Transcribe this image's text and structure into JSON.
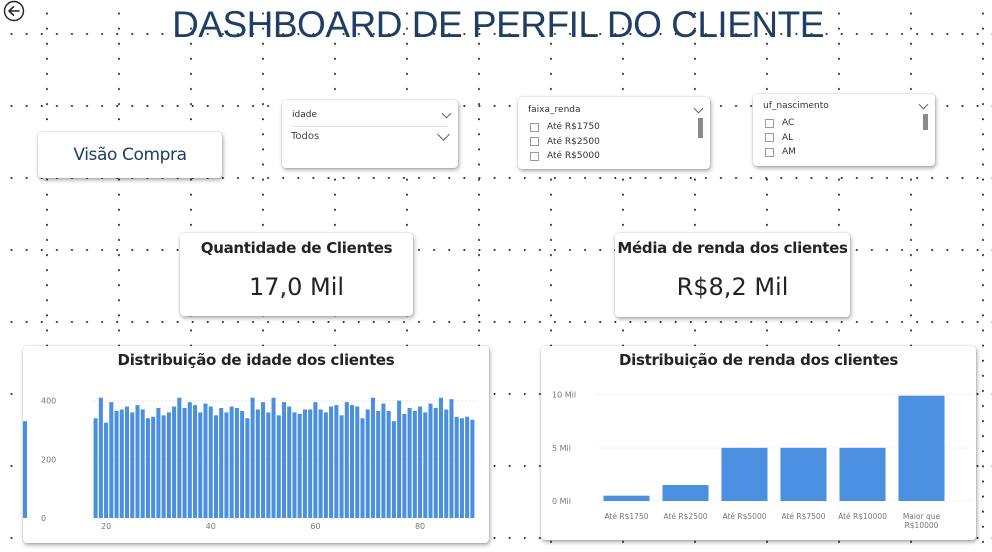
{
  "header": {
    "title": "DASHBOARD DE PERFIL DO CLIENTE"
  },
  "nav": {
    "visao_label": "Visão Compra"
  },
  "slicers": {
    "idade": {
      "label": "idade",
      "selected": "Todos"
    },
    "faixa_renda": {
      "label": "faixa_renda",
      "options": [
        "Até R$1750",
        "Até R$2500",
        "Até R$5000"
      ]
    },
    "uf_nascimento": {
      "label": "uf_nascimento",
      "options": [
        "AC",
        "AL",
        "AM"
      ]
    }
  },
  "kpis": {
    "quantidade": {
      "title": "Quantidade de Clientes",
      "value": "17,0 Mil"
    },
    "media_renda": {
      "title": "Média de renda dos clientes",
      "value": "R$8,2 Mil"
    }
  },
  "colors": {
    "bar": "#4a8fe0",
    "title": "#1f3e63"
  },
  "chart_data": [
    {
      "type": "bar",
      "title": "Distribuição de idade dos clientes",
      "x": [
        18,
        19,
        20,
        21,
        22,
        23,
        24,
        25,
        26,
        27,
        28,
        29,
        30,
        31,
        32,
        33,
        34,
        35,
        36,
        37,
        38,
        39,
        40,
        41,
        42,
        43,
        44,
        45,
        46,
        47,
        48,
        49,
        50,
        51,
        52,
        53,
        54,
        55,
        56,
        57,
        58,
        59,
        60,
        61,
        62,
        63,
        64,
        65,
        66,
        67,
        68,
        69,
        70,
        71,
        72,
        73,
        74,
        75,
        76,
        77,
        78,
        79,
        80,
        81,
        82,
        83,
        84,
        85,
        86,
        87,
        88,
        89,
        90
      ],
      "values": [
        340,
        410,
        325,
        395,
        365,
        370,
        380,
        360,
        385,
        370,
        340,
        345,
        375,
        350,
        360,
        380,
        410,
        375,
        395,
        385,
        360,
        390,
        380,
        350,
        375,
        360,
        380,
        375,
        365,
        340,
        410,
        370,
        395,
        360,
        410,
        350,
        395,
        380,
        360,
        355,
        370,
        370,
        395,
        370,
        360,
        380,
        385,
        350,
        395,
        385,
        380,
        340,
        370,
        410,
        365,
        390,
        365,
        330,
        400,
        355,
        375,
        365,
        380,
        360,
        390,
        375,
        410,
        370,
        405,
        345,
        340,
        345,
        335,
        330
      ],
      "xticks": [
        "20",
        "40",
        "60",
        "80"
      ],
      "yticks": [
        "0",
        "200",
        "400"
      ],
      "ylim": [
        0,
        450
      ]
    },
    {
      "type": "bar",
      "title": "Distribuição de renda dos clientes",
      "categories": [
        "Até R$1750",
        "Até R$2500",
        "Até R$5000",
        "Até R$7500",
        "Até R$10000",
        "Maior que R$10000"
      ],
      "values": [
        0.5,
        1.5,
        5.0,
        5.0,
        5.0,
        9.9
      ],
      "yticks": [
        "0 Mil",
        "5 Mil",
        "10 Mil"
      ],
      "ylim": [
        0,
        11
      ]
    }
  ]
}
